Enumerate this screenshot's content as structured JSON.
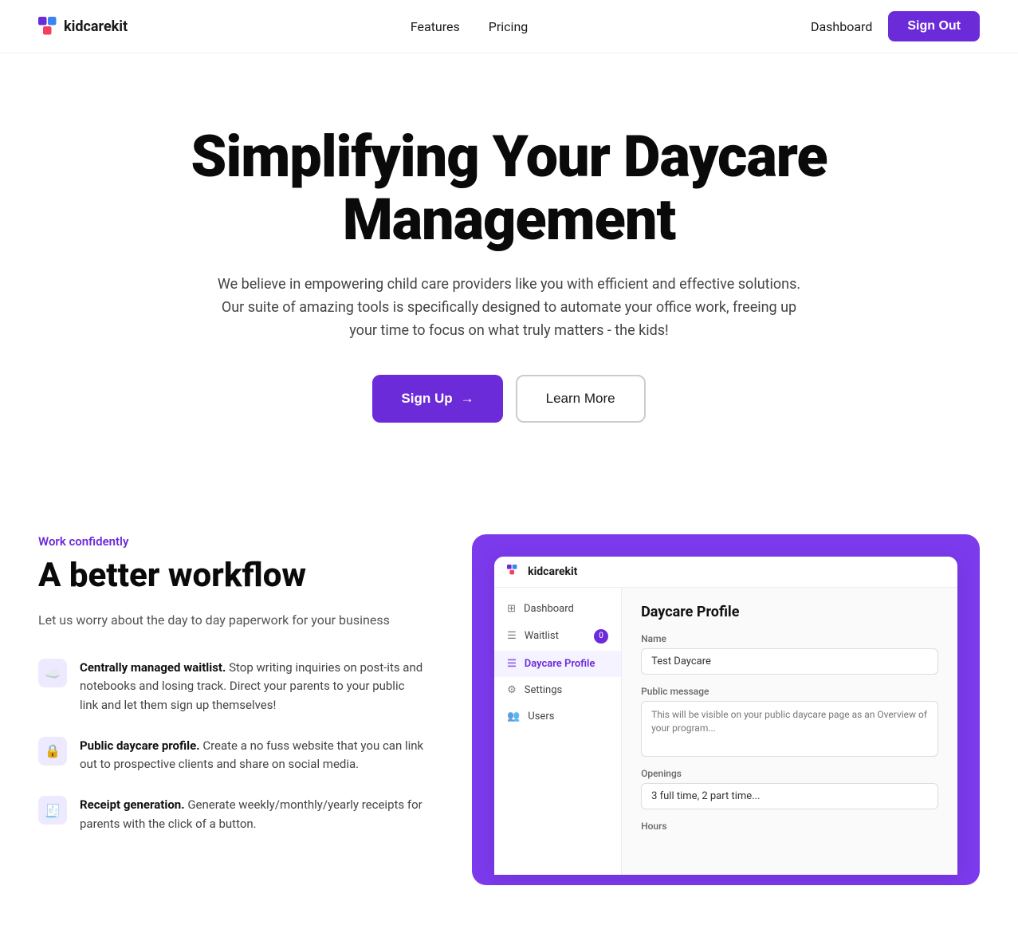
{
  "nav": {
    "logo_text": "kidcarekit",
    "links": [
      {
        "label": "Features",
        "name": "nav-features"
      },
      {
        "label": "Pricing",
        "name": "nav-pricing"
      }
    ],
    "dashboard_label": "Dashboard",
    "sign_out_label": "Sign Out"
  },
  "hero": {
    "title": "Simplifying Your Daycare Management",
    "subtitle": "We believe in empowering child care providers like you with efficient and effective solutions. Our suite of amazing tools is specifically designed to automate your office work, freeing up your time to focus on what truly matters - the kids!",
    "signup_label": "Sign Up",
    "learn_more_label": "Learn More"
  },
  "features": {
    "eyebrow": "Work confidently",
    "heading": "A better workflow",
    "description": "Let us worry about the day to day paperwork for your business",
    "items": [
      {
        "icon": "☁",
        "bold": "Centrally managed waitlist.",
        "text": " Stop writing inquiries on post-its and notebooks and losing track. Direct your parents to your public link and let them sign up themselves!"
      },
      {
        "icon": "🔒",
        "bold": "Public daycare profile.",
        "text": " Create a no fuss website that you can link out to prospective clients and share on social media."
      },
      {
        "icon": "🧾",
        "bold": "Receipt generation.",
        "text": " Generate weekly/monthly/yearly receipts for parents with the click of a button."
      }
    ]
  },
  "preview": {
    "logo_text": "kidcarekit",
    "sidebar": [
      {
        "icon": "⊞",
        "label": "Dashboard",
        "active": false
      },
      {
        "icon": "☰",
        "label": "Waitlist",
        "active": false,
        "badge": "0"
      },
      {
        "icon": "☰",
        "label": "Daycare Profile",
        "active": true
      },
      {
        "icon": "⚙",
        "label": "Settings",
        "active": false
      },
      {
        "icon": "👥",
        "label": "Users",
        "active": false
      }
    ],
    "content": {
      "title": "Daycare Profile",
      "name_label": "Name",
      "name_value": "Test Daycare",
      "public_message_label": "Public message",
      "public_message_placeholder": "This will be visible on your public daycare page as an Overview of your program...",
      "openings_label": "Openings",
      "openings_value": "3 full time, 2 part time...",
      "hours_label": "Hours"
    }
  }
}
